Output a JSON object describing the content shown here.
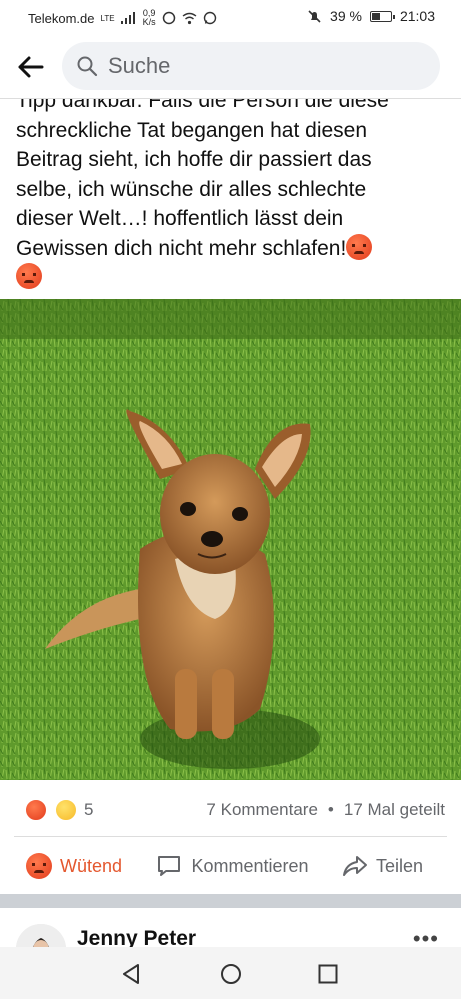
{
  "status_bar": {
    "carrier": "Telekom.de",
    "network": "LTE",
    "speed_value": "0,9",
    "speed_unit": "K/s",
    "battery": "39 %",
    "battery_level": 0.39,
    "time": "21:03"
  },
  "header": {
    "search_placeholder": "Suche"
  },
  "post": {
    "text_lines": [
      "Tipp dankbar. Falls die Person die diese",
      "schreckliche Tat begangen hat diesen",
      "Beitrag sieht, ich hoffe dir passiert das",
      "selbe, ich wünsche dir alles schlechte",
      "dieser Welt…! hoffentlich lässt dein",
      "Gewissen dich nicht mehr schlafen!"
    ],
    "reaction_count": "5",
    "comments": "7 Kommentare",
    "bullet": "•",
    "shares": "17 Mal geteilt"
  },
  "actions": {
    "react_label": "Wütend",
    "comment_label": "Kommentieren",
    "share_label": "Teilen"
  },
  "next_post": {
    "author": "Jenny Peter",
    "more": "•••"
  },
  "colors": {
    "accent_angry": "#e4572e",
    "grass": "#5f9a2c"
  }
}
